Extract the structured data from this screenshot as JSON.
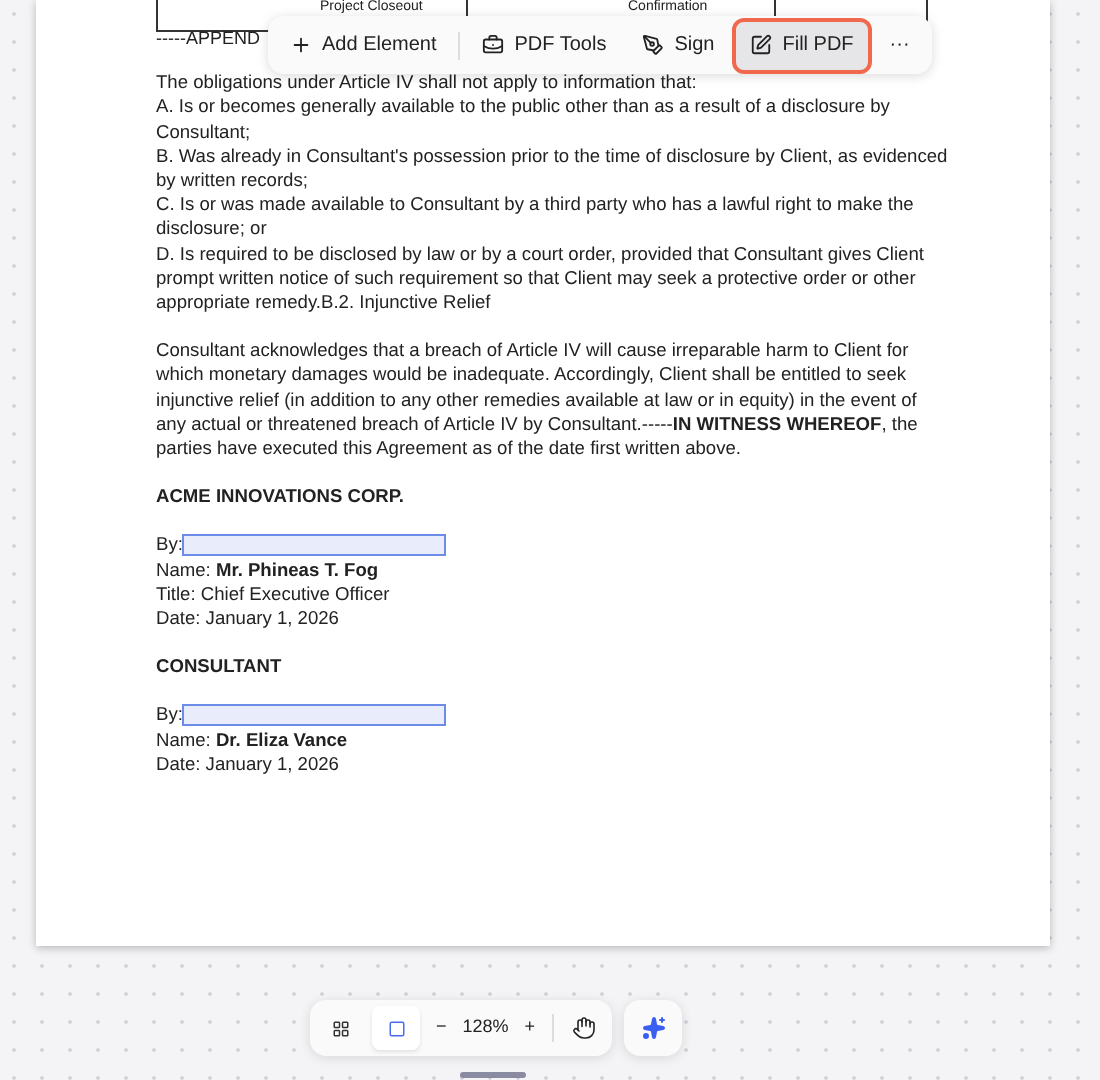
{
  "table_cells": [
    "Project Closeout",
    "Confirmation"
  ],
  "appendix_text": "-----APPEND",
  "toolbar": [
    {
      "kind": "add",
      "label": "Add Element",
      "selected": false
    },
    {
      "kind": "tools",
      "label": "PDF Tools",
      "selected": false
    },
    {
      "kind": "sign",
      "label": "Sign",
      "selected": false
    },
    {
      "kind": "fill",
      "label": "Fill PDF",
      "selected": true
    },
    {
      "kind": "more",
      "label": "···",
      "selected": false
    }
  ],
  "paragraphs": [
    "The obligations under Article IV shall not apply to information that:\nA. Is or becomes generally available to the public other than as a result of a disclosure by Consultant;\nB. Was already in Consultant's possession prior to the time of disclosure by Client, as evidenced by written records;\nC. Is or was made available to Consultant by a third party who has a lawful right to make the disclosure; or\nD. Is required to be disclosed by law or by a court order, provided that Consultant gives Client prompt written notice of such requirement so that Client may seek a protective order or other appropriate remedy.B.2. Injunctive Relief",
    "Consultant acknowledges that a breach of Article IV will cause irreparable harm to Client for which monetary damages would be inadequate. Accordingly, Client shall be entitled to seek injunctive relief (in addition to any other remedies available at law or in equity) in the event of any actual or threatened breach of Article IV by Consultant.-----**IN WITNESS WHEREOF**, the parties have executed this Agreement as of the date first written above."
  ],
  "signatories": [
    {
      "party": "ACME INNOVATIONS CORP.",
      "by_label": "By:",
      "lines": [
        "Name: **Mr. Phineas T. Fog**",
        "Title: Chief Executive Officer",
        "Date: January 1, 2026"
      ]
    },
    {
      "party": "CONSULTANT",
      "by_label": "By:",
      "lines": [
        "Name: **Dr. Eliza Vance**",
        "Date: January 1, 2026"
      ]
    }
  ],
  "view_modes": [
    {
      "kind": "grid",
      "selected": false
    },
    {
      "kind": "single",
      "selected": true
    }
  ],
  "zoom": {
    "minus": "−",
    "value": "128%",
    "plus": "+"
  }
}
